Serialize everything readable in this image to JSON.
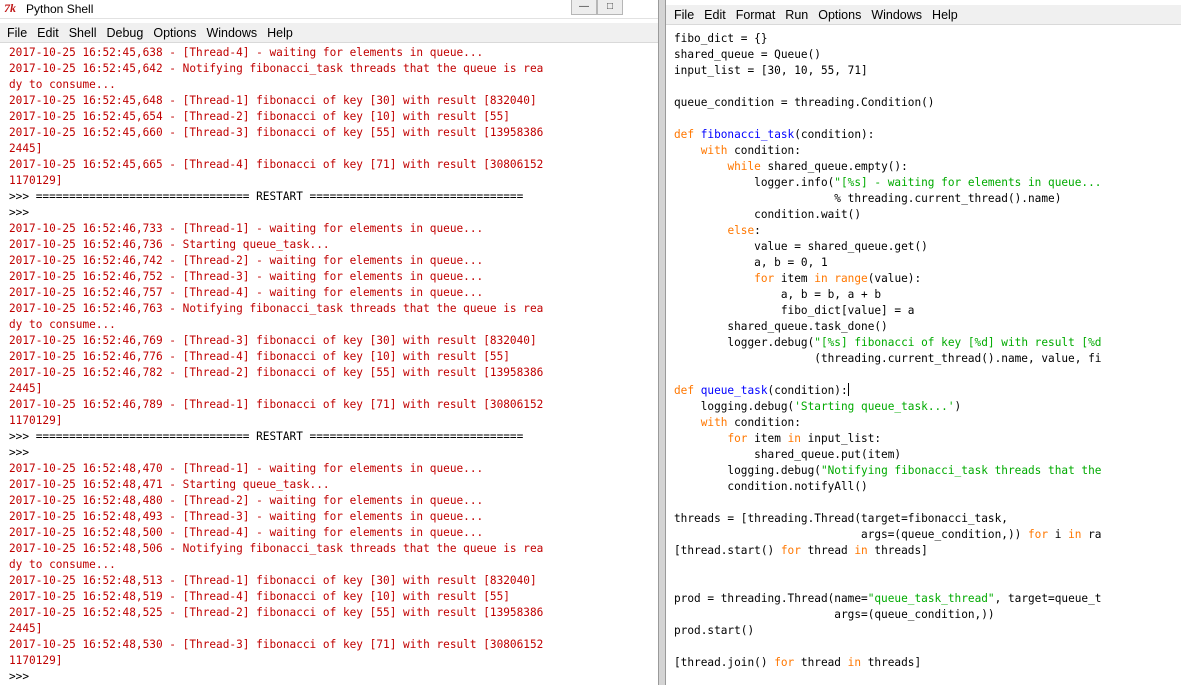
{
  "shell": {
    "title": "Python Shell",
    "tk_icon_glyph": "7k",
    "controls": {
      "minimize": "—",
      "maximize": "□"
    },
    "menu": [
      "File",
      "Edit",
      "Shell",
      "Debug",
      "Options",
      "Windows",
      "Help"
    ],
    "lines": [
      {
        "kind": "r",
        "text": "2017-10-25 16:52:45,638 - [Thread-4] - waiting for elements in queue..."
      },
      {
        "kind": "r",
        "text": "2017-10-25 16:52:45,642 - Notifying fibonacci_task threads that the queue is rea"
      },
      {
        "kind": "r",
        "text": "dy to consume..."
      },
      {
        "kind": "r",
        "text": "2017-10-25 16:52:45,648 - [Thread-1] fibonacci of key [30] with result [832040]"
      },
      {
        "kind": "r",
        "text": "2017-10-25 16:52:45,654 - [Thread-2] fibonacci of key [10] with result [55]"
      },
      {
        "kind": "r",
        "text": "2017-10-25 16:52:45,660 - [Thread-3] fibonacci of key [55] with result [13958386"
      },
      {
        "kind": "r",
        "text": "2445]"
      },
      {
        "kind": "r",
        "text": "2017-10-25 16:52:45,665 - [Thread-4] fibonacci of key [71] with result [30806152"
      },
      {
        "kind": "r",
        "text": "1170129]"
      },
      {
        "kind": "p",
        "text": ">>> ================================ RESTART ================================"
      },
      {
        "kind": "p",
        "text": ">>> "
      },
      {
        "kind": "r",
        "text": "2017-10-25 16:52:46,733 - [Thread-1] - waiting for elements in queue..."
      },
      {
        "kind": "r",
        "text": "2017-10-25 16:52:46,736 - Starting queue_task..."
      },
      {
        "kind": "r",
        "text": "2017-10-25 16:52:46,742 - [Thread-2] - waiting for elements in queue..."
      },
      {
        "kind": "r",
        "text": "2017-10-25 16:52:46,752 - [Thread-3] - waiting for elements in queue..."
      },
      {
        "kind": "r",
        "text": "2017-10-25 16:52:46,757 - [Thread-4] - waiting for elements in queue..."
      },
      {
        "kind": "r",
        "text": "2017-10-25 16:52:46,763 - Notifying fibonacci_task threads that the queue is rea"
      },
      {
        "kind": "r",
        "text": "dy to consume..."
      },
      {
        "kind": "r",
        "text": "2017-10-25 16:52:46,769 - [Thread-3] fibonacci of key [30] with result [832040]"
      },
      {
        "kind": "r",
        "text": "2017-10-25 16:52:46,776 - [Thread-4] fibonacci of key [10] with result [55]"
      },
      {
        "kind": "r",
        "text": "2017-10-25 16:52:46,782 - [Thread-2] fibonacci of key [55] with result [13958386"
      },
      {
        "kind": "r",
        "text": "2445]"
      },
      {
        "kind": "r",
        "text": "2017-10-25 16:52:46,789 - [Thread-1] fibonacci of key [71] with result [30806152"
      },
      {
        "kind": "r",
        "text": "1170129]"
      },
      {
        "kind": "p",
        "text": ">>> ================================ RESTART ================================"
      },
      {
        "kind": "p",
        "text": ">>> "
      },
      {
        "kind": "r",
        "text": "2017-10-25 16:52:48,470 - [Thread-1] - waiting for elements in queue..."
      },
      {
        "kind": "r",
        "text": "2017-10-25 16:52:48,471 - Starting queue_task..."
      },
      {
        "kind": "r",
        "text": "2017-10-25 16:52:48,480 - [Thread-2] - waiting for elements in queue..."
      },
      {
        "kind": "r",
        "text": "2017-10-25 16:52:48,493 - [Thread-3] - waiting for elements in queue..."
      },
      {
        "kind": "r",
        "text": "2017-10-25 16:52:48,500 - [Thread-4] - waiting for elements in queue..."
      },
      {
        "kind": "r",
        "text": "2017-10-25 16:52:48,506 - Notifying fibonacci_task threads that the queue is rea"
      },
      {
        "kind": "r",
        "text": "dy to consume..."
      },
      {
        "kind": "r",
        "text": "2017-10-25 16:52:48,513 - [Thread-1] fibonacci of key [30] with result [832040]"
      },
      {
        "kind": "r",
        "text": "2017-10-25 16:52:48,519 - [Thread-4] fibonacci of key [10] with result [55]"
      },
      {
        "kind": "r",
        "text": "2017-10-25 16:52:48,525 - [Thread-2] fibonacci of key [55] with result [13958386"
      },
      {
        "kind": "r",
        "text": "2445]"
      },
      {
        "kind": "r",
        "text": "2017-10-25 16:52:48,530 - [Thread-3] fibonacci of key [71] with result [30806152"
      },
      {
        "kind": "r",
        "text": "1170129]"
      },
      {
        "kind": "p",
        "text": ">>> "
      }
    ]
  },
  "editor": {
    "menu": [
      "File",
      "Edit",
      "Format",
      "Run",
      "Options",
      "Windows",
      "Help"
    ],
    "lines": [
      [
        [
          "p",
          "fibo_dict = {}"
        ]
      ],
      [
        [
          "p",
          "shared_queue = Queue()"
        ]
      ],
      [
        [
          "p",
          "input_list = [30, 10, 55, 71]"
        ]
      ],
      [],
      [
        [
          "p",
          "queue_condition = threading.Condition()"
        ]
      ],
      [],
      [
        [
          "k",
          "def "
        ],
        [
          "f",
          "fibonacci_task"
        ],
        [
          "p",
          "(condition):"
        ]
      ],
      [
        [
          "p",
          "    "
        ],
        [
          "k",
          "with"
        ],
        [
          "p",
          " condition:"
        ]
      ],
      [
        [
          "p",
          "        "
        ],
        [
          "k",
          "while"
        ],
        [
          "p",
          " shared_queue.empty():"
        ]
      ],
      [
        [
          "p",
          "            logger.info("
        ],
        [
          "s",
          "\"[%s] - waiting for elements in queue..."
        ]
      ],
      [
        [
          "p",
          "                        % threading.current_thread().name)"
        ]
      ],
      [
        [
          "p",
          "            condition.wait()"
        ]
      ],
      [
        [
          "p",
          "        "
        ],
        [
          "k",
          "else"
        ],
        [
          "p",
          ":"
        ]
      ],
      [
        [
          "p",
          "            value = shared_queue.get()"
        ]
      ],
      [
        [
          "p",
          "            a, b = 0, 1"
        ]
      ],
      [
        [
          "p",
          "            "
        ],
        [
          "k",
          "for"
        ],
        [
          "p",
          " item "
        ],
        [
          "k",
          "in"
        ],
        [
          "p",
          " "
        ],
        [
          "k",
          "range"
        ],
        [
          "p",
          "(value):"
        ]
      ],
      [
        [
          "p",
          "                a, b = b, a + b"
        ]
      ],
      [
        [
          "p",
          "                fibo_dict[value] = a"
        ]
      ],
      [
        [
          "p",
          "        shared_queue.task_done()"
        ]
      ],
      [
        [
          "p",
          "        logger.debug("
        ],
        [
          "s",
          "\"[%s] fibonacci of key [%d] with result [%d"
        ]
      ],
      [
        [
          "p",
          "                     (threading.current_thread().name, value, fi"
        ]
      ],
      [],
      [
        [
          "k",
          "def "
        ],
        [
          "f",
          "queue_task"
        ],
        [
          "p",
          "(condition):"
        ]
      ],
      [
        [
          "p",
          "    logging.debug("
        ],
        [
          "s",
          "'Starting queue_task...'"
        ],
        [
          "p",
          ")"
        ]
      ],
      [
        [
          "p",
          "    "
        ],
        [
          "k",
          "with"
        ],
        [
          "p",
          " condition:"
        ]
      ],
      [
        [
          "p",
          "        "
        ],
        [
          "k",
          "for"
        ],
        [
          "p",
          " item "
        ],
        [
          "k",
          "in"
        ],
        [
          "p",
          " input_list:"
        ]
      ],
      [
        [
          "p",
          "            shared_queue.put(item)"
        ]
      ],
      [
        [
          "p",
          "        logging.debug("
        ],
        [
          "s",
          "\"Notifying fibonacci_task threads that the"
        ]
      ],
      [
        [
          "p",
          "        condition.notifyAll()"
        ]
      ],
      [],
      [
        [
          "p",
          "threads = [threading.Thread(target=fibonacci_task,"
        ]
      ],
      [
        [
          "p",
          "                            args=(queue_condition,)) "
        ],
        [
          "k",
          "for"
        ],
        [
          "p",
          " i "
        ],
        [
          "k",
          "in"
        ],
        [
          "p",
          " ra"
        ]
      ],
      [
        [
          "p",
          "[thread.start() "
        ],
        [
          "k",
          "for"
        ],
        [
          "p",
          " thread "
        ],
        [
          "k",
          "in"
        ],
        [
          "p",
          " threads]"
        ]
      ],
      [],
      [],
      [
        [
          "p",
          "prod = threading.Thread(name="
        ],
        [
          "s",
          "\"queue_task_thread\""
        ],
        [
          "p",
          ", target=queue_t"
        ]
      ],
      [
        [
          "p",
          "                        args=(queue_condition,))"
        ]
      ],
      [
        [
          "p",
          "prod.start()"
        ]
      ],
      [],
      [
        [
          "p",
          "[thread.join() "
        ],
        [
          "k",
          "for"
        ],
        [
          "p",
          " thread "
        ],
        [
          "k",
          "in"
        ],
        [
          "p",
          " threads]"
        ]
      ]
    ]
  }
}
